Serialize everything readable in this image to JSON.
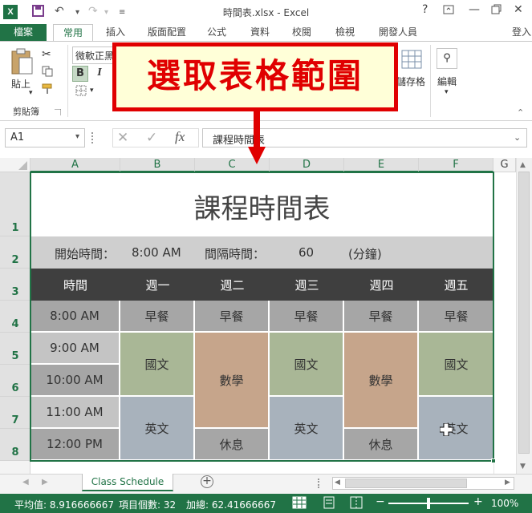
{
  "titlebar": {
    "title": "時間表.xlsx - Excel",
    "help": "?",
    "app_icon": "X"
  },
  "ribbon_tabs": [
    "檔案",
    "常用",
    "插入",
    "版面配置",
    "公式",
    "資料",
    "校閱",
    "檢視",
    "開發人員"
  ],
  "signin": "登入",
  "ribbon": {
    "paste_label": "貼上",
    "clipboard_label": "剪貼簿",
    "font_name": "微軟正黑",
    "bold": "B",
    "italic": "I",
    "cell_styles_label": "儲存格",
    "editing_label": "編輯"
  },
  "callout": {
    "text": "選取表格範圍"
  },
  "formula_bar": {
    "name_box": "A1",
    "fx": "fx",
    "content": "課程時間表"
  },
  "columns": [
    "A",
    "B",
    "C",
    "D",
    "E",
    "F",
    "G"
  ],
  "rows": [
    "1",
    "2",
    "3",
    "4",
    "5",
    "6",
    "7",
    "8"
  ],
  "sheet": {
    "title": "課程時間表",
    "start_label": "開始時間：",
    "start_value": "8:00 AM",
    "interval_label": "間隔時間：",
    "interval_value": "60",
    "interval_unit": "(分鐘)",
    "headers": [
      "時間",
      "週一",
      "週二",
      "週三",
      "週四",
      "週五"
    ],
    "times": [
      "8:00 AM",
      "9:00 AM",
      "10:00 AM",
      "11:00 AM",
      "12:00 PM"
    ],
    "breakfast": "早餐",
    "chinese": "國文",
    "math": "數學",
    "english": "英文",
    "rest": "休息"
  },
  "sheet_tab": {
    "name": "Class Schedule"
  },
  "status_bar": {
    "average": "平均值: 8.916666667",
    "count": "項目個數: 32",
    "sum": "加總: 62.41666667",
    "zoom": "100%"
  },
  "colors": {
    "accent": "#217346",
    "callout_border": "#e00000",
    "callout_fill": "#ffffd8",
    "header_dark": "#3f3f3f",
    "green_cell": "#a9b796",
    "orange_cell": "#c6a58b",
    "blue_cell": "#a8b2bc",
    "grey_cell": "#a6a6a6"
  }
}
